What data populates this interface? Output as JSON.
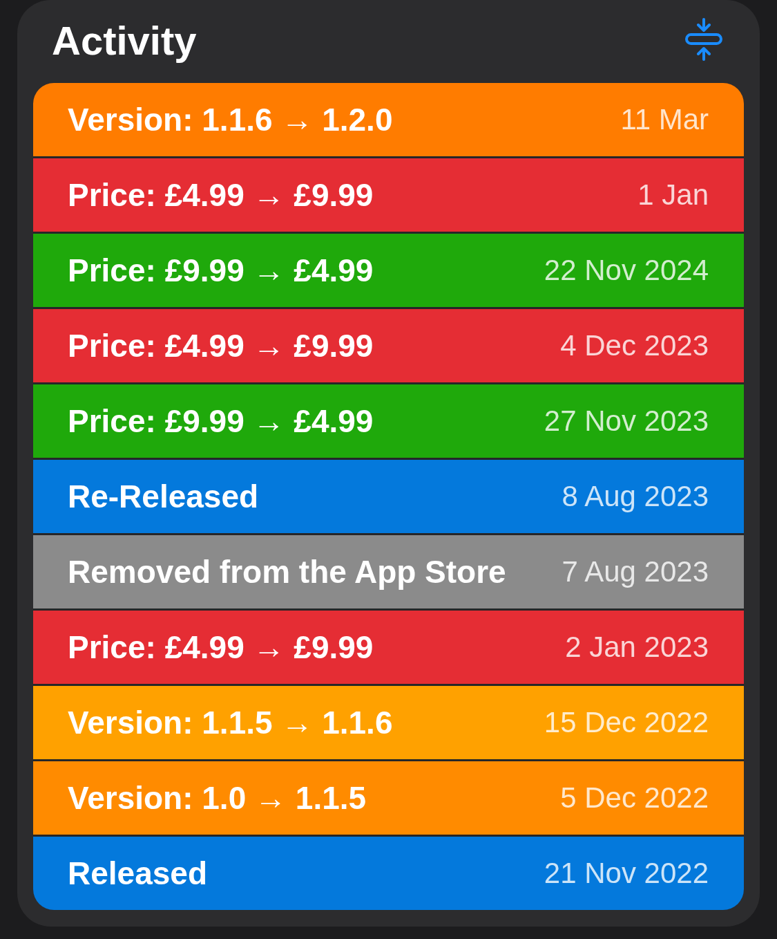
{
  "header": {
    "title": "Activity"
  },
  "rows": [
    {
      "change": "Version: 1.1.6 → 1.2.0",
      "date": "11 Mar",
      "color": "#ff7c00"
    },
    {
      "change": "Price: £4.99 → £9.99",
      "date": "1 Jan",
      "color": "#e52d34"
    },
    {
      "change": "Price: £9.99 → £4.99",
      "date": "22 Nov 2024",
      "color": "#1fa90b"
    },
    {
      "change": "Price: £4.99 → £9.99",
      "date": "4 Dec 2023",
      "color": "#e52d34"
    },
    {
      "change": "Price: £9.99 → £4.99",
      "date": "27 Nov 2023",
      "color": "#1fa90b"
    },
    {
      "change": "Re-Released",
      "date": "8 Aug 2023",
      "color": "#0479dc"
    },
    {
      "change": "Removed from the App Store",
      "date": "7 Aug 2023",
      "color": "#8b8b8b"
    },
    {
      "change": "Price: £4.99 → £9.99",
      "date": "2 Jan 2023",
      "color": "#e52d34"
    },
    {
      "change": "Version: 1.1.5 → 1.1.6",
      "date": "15 Dec 2022",
      "color": "#ffa100"
    },
    {
      "change": "Version: 1.0 → 1.1.5",
      "date": "5 Dec 2022",
      "color": "#ff8b00"
    },
    {
      "change": "Released",
      "date": "21 Nov 2022",
      "color": "#0479dc"
    }
  ]
}
